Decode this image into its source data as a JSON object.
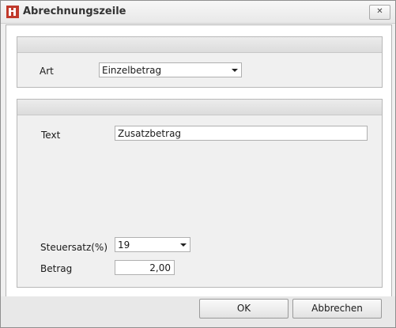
{
  "window": {
    "title": "Abrechnungszeile",
    "close_glyph": "✕",
    "icon": "app-logo-icon",
    "accent_color": "#c0392b"
  },
  "art_group": {
    "art_label": "Art",
    "art_value": "Einzelbetrag"
  },
  "details_group": {
    "text_label": "Text",
    "text_value": "Zusatzbetrag",
    "steuersatz_label": "Steuersatz(%)",
    "steuersatz_value": "19",
    "betrag_label": "Betrag",
    "betrag_value": "2,00"
  },
  "buttons": {
    "ok_label": "OK",
    "cancel_label": "Abbrechen"
  }
}
